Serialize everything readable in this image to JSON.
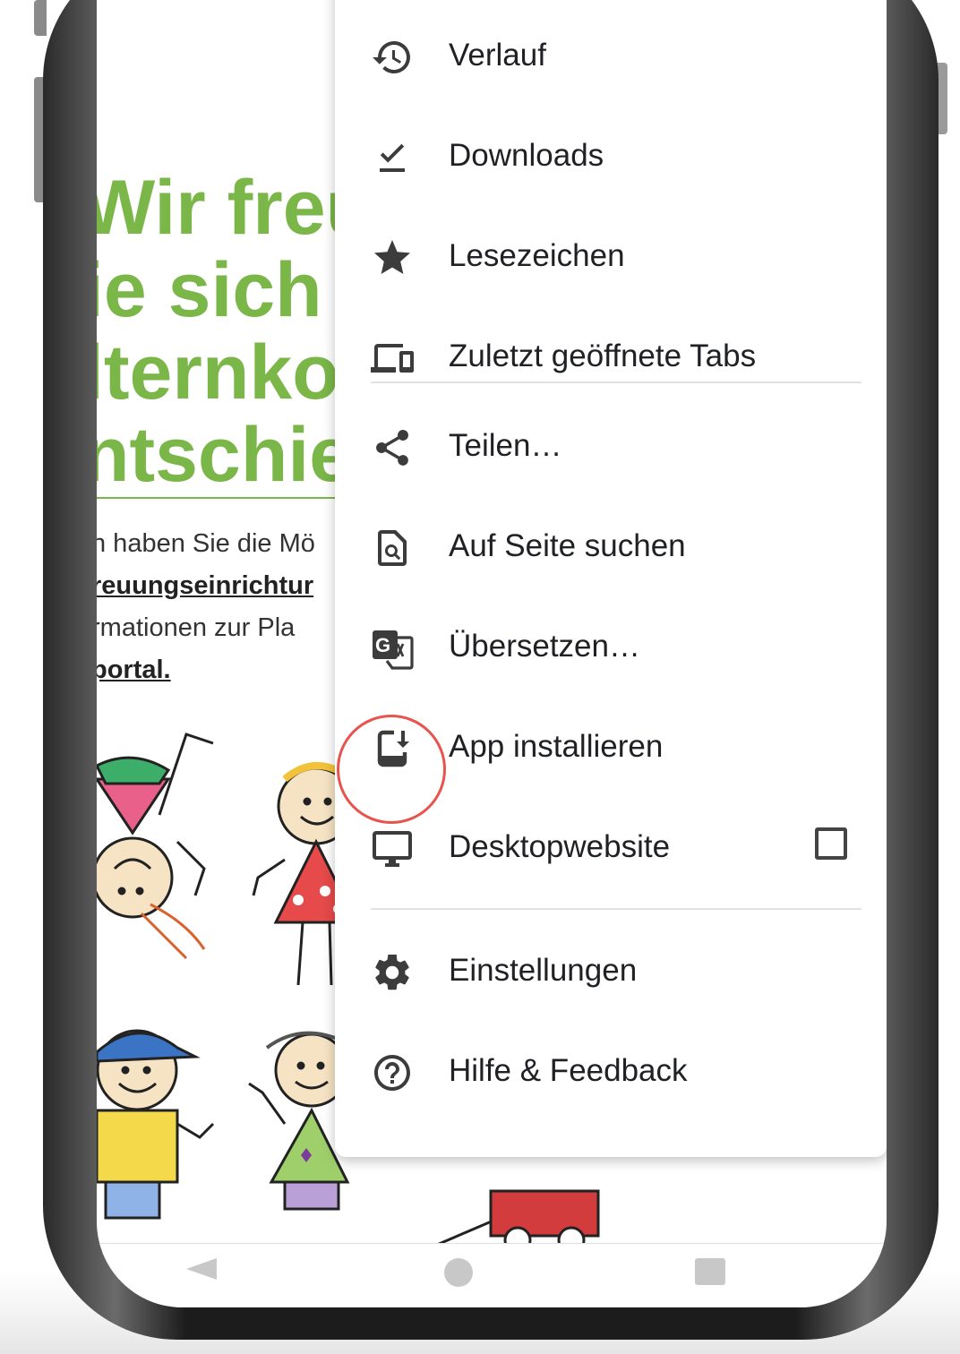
{
  "website": {
    "headline_lines": [
      "Wir freu",
      "ie sich",
      "lternko",
      "ntschie"
    ],
    "intro_lines": [
      "n haben Sie die Mö",
      "reuungseinrichtur",
      "rmationen zur Pla",
      "portal."
    ]
  },
  "menu": {
    "items": [
      {
        "label": "Verlauf",
        "icon": "history-icon"
      },
      {
        "label": "Downloads",
        "icon": "downloads-icon"
      },
      {
        "label": "Lesezeichen",
        "icon": "star-icon"
      },
      {
        "label": "Zuletzt geöffnete Tabs",
        "icon": "devices-icon"
      },
      {
        "label": "Teilen…",
        "icon": "share-icon"
      },
      {
        "label": "Auf Seite suchen",
        "icon": "find-in-page-icon"
      },
      {
        "label": "Übersetzen…",
        "icon": "translate-icon"
      },
      {
        "label": "App installieren",
        "icon": "install-app-icon"
      },
      {
        "label": "Desktopwebsite",
        "icon": "desktop-icon",
        "checked": false
      },
      {
        "label": "Einstellungen",
        "icon": "gear-icon"
      },
      {
        "label": "Hilfe & Feedback",
        "icon": "help-icon"
      }
    ]
  },
  "annotation": {
    "highlight_color": "#e8534e",
    "highlighted_item": "App installieren"
  },
  "colors": {
    "brand_green": "#7ab648",
    "icon_gray": "#3c3c3c"
  }
}
